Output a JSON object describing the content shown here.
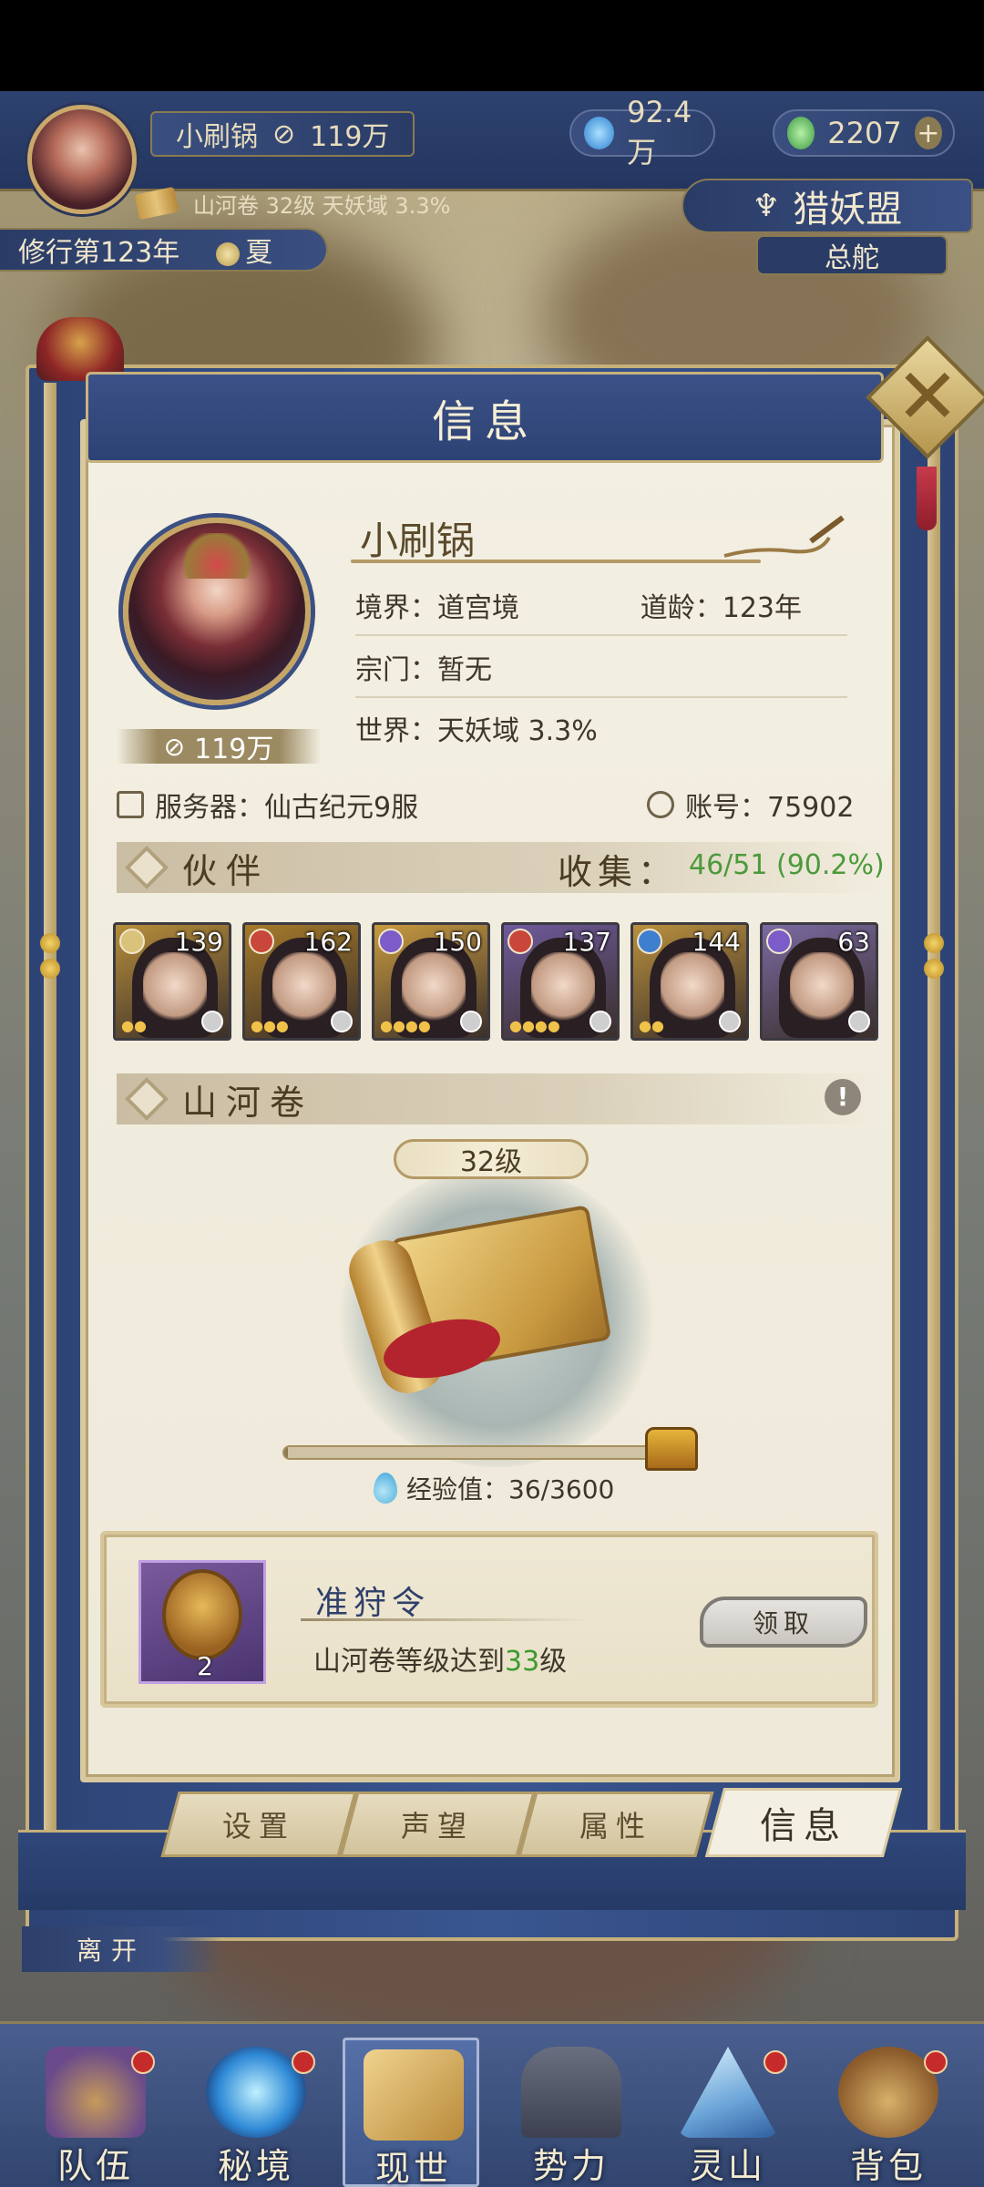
{
  "hud": {
    "player_name": "小刷锅",
    "power": "119万",
    "currency_1": "92.4万",
    "currency_2": "2207",
    "add_symbol": "+",
    "region_text": "山河卷 32级 天妖域 3.3%",
    "cultivation_year": "修行第123年",
    "season": "夏",
    "alliance_name": "猎妖盟",
    "alliance_sub": "总舵"
  },
  "panel": {
    "title": "信息",
    "close_symbol": "✕",
    "player_name": "小刷锅",
    "power_badge": "119万",
    "realm": "境界：道宫境",
    "age": "道龄：123年",
    "sect": "宗门：暂无",
    "world": "世界：天妖域 3.3%",
    "server": "服务器：仙古纪元9服",
    "account": "账号：75902"
  },
  "partners_section": {
    "title": "伙伴",
    "collect_label": "收集：",
    "collect_value": "46/51 (90.2%)",
    "cards": [
      {
        "level": "139",
        "stars": "●●",
        "elem_color": "#d9c27a",
        "bg": "#b58d3a"
      },
      {
        "level": "162",
        "stars": "●●●",
        "elem_color": "#c9473a",
        "bg": "#a57a2a"
      },
      {
        "level": "150",
        "stars": "●●●●",
        "elem_color": "#7b5cc8",
        "bg": "#c79a40"
      },
      {
        "level": "137",
        "stars": "●●●●",
        "elem_color": "#c9473a",
        "bg": "#6f5a9c"
      },
      {
        "level": "144",
        "stars": "●●",
        "elem_color": "#3f7fd0",
        "bg": "#b9903e"
      },
      {
        "level": "63",
        "stars": "",
        "elem_color": "#7b5cc8",
        "bg": "#7a6aa2"
      }
    ]
  },
  "scroll_section": {
    "title": "山河卷",
    "alert": "!",
    "level": "32级",
    "exp_text": "经验值：36/3600",
    "exp_progress": 0.01
  },
  "reward": {
    "title": "准狩令",
    "count": "2",
    "desc_prefix": "山河卷等级达到",
    "desc_highlight": "33",
    "desc_suffix": "级",
    "claim_label": "领取"
  },
  "tabs": [
    {
      "label": "设置"
    },
    {
      "label": "声望"
    },
    {
      "label": "属性"
    },
    {
      "label": "信息"
    }
  ],
  "leave_label": "离开",
  "bottom_nav": [
    {
      "label": "队伍"
    },
    {
      "label": "秘境"
    },
    {
      "label": "现世"
    },
    {
      "label": "势力"
    },
    {
      "label": "灵山"
    },
    {
      "label": "背包"
    }
  ]
}
